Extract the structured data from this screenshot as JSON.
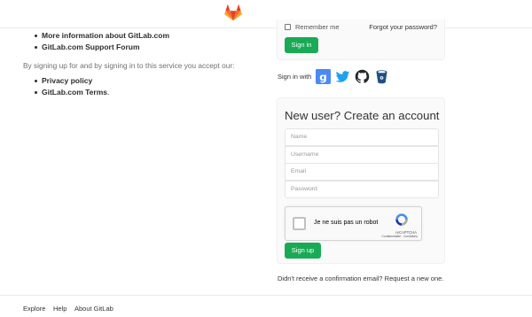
{
  "header": {
    "logo": "gitlab-tanuki-logo"
  },
  "left": {
    "links_top": [
      "More information about GitLab.com",
      "GitLab.com Support Forum"
    ],
    "agreement_text": "By signing up for and by signing in to this service you accept our:",
    "links_bottom": [
      {
        "label": "Privacy policy",
        "suffix": ""
      },
      {
        "label": "GitLab.com Terms",
        "suffix": "."
      }
    ]
  },
  "signin": {
    "remember_label": "Remember me",
    "forgot_label": "Forgot your password?",
    "button_label": "Sign in",
    "remember_checked": false
  },
  "sign_in_with": {
    "label": "Sign in with",
    "providers": [
      "google-icon",
      "twitter-icon",
      "github-icon",
      "bitbucket-icon"
    ]
  },
  "register": {
    "title": "New user? Create an account",
    "fields": [
      {
        "placeholder": "Name"
      },
      {
        "placeholder": "Username"
      },
      {
        "placeholder": "Email"
      },
      {
        "placeholder": "Password"
      }
    ],
    "captcha": {
      "label": "Je ne suis pas un robot",
      "brand": "reCAPTCHA",
      "terms": "Confidentialité - Conditions"
    },
    "button_label": "Sign up"
  },
  "confirm": {
    "text": "Didn't receive a confirmation email?",
    "link": "Request a new one."
  },
  "footer": {
    "links": [
      "Explore",
      "Help",
      "About GitLab"
    ]
  },
  "colors": {
    "accent": "#1aaa55",
    "brand_orange": "#fc6d26"
  }
}
